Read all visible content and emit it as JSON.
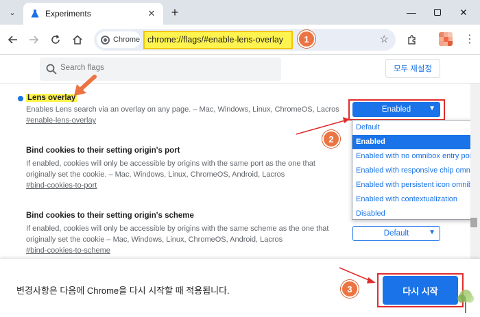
{
  "tab": {
    "title": "Experiments"
  },
  "omnibox": {
    "chip_label": "Chrome",
    "url": "chrome://flags/#enable-lens-overlay"
  },
  "flags": {
    "search_placeholder": "Search flags",
    "reset_label": "모두 재설정"
  },
  "experiments": [
    {
      "title": "Lens overlay",
      "description": "Enables Lens search via an overlay on any page. – Mac, Windows, Linux, ChromeOS, Lacros",
      "link": "#enable-lens-overlay",
      "selected": "Enabled"
    },
    {
      "title": "Bind cookies to their setting origin's port",
      "description_line1": "If enabled, cookies will only be accessible by origins with the same port as the one that",
      "description_line2": "originally set the cookie. – Mac, Windows, Linux, ChromeOS, Android, Lacros",
      "link": "#bind-cookies-to-port"
    },
    {
      "title": "Bind cookies to their setting origin's scheme",
      "description_line1": "If enabled, cookies will only be accessible by origins with the same scheme as the one that",
      "description_line2": "originally set the cookie – Mac, Windows, Linux, ChromeOS, Android, Lacros",
      "link": "#bind-cookies-to-scheme",
      "selected": "Default"
    }
  ],
  "dropdown_options": [
    "Default",
    "Enabled",
    "Enabled with no omnibox entry point",
    "Enabled with responsive chip omnibox",
    "Enabled with persistent icon omnibox",
    "Enabled with contextualization",
    "Disabled"
  ],
  "bottom": {
    "message": "변경사항은 다음에 Chrome을 다시 시작할 때 적용됩니다.",
    "relaunch_label": "다시 시작"
  },
  "annotations": {
    "badge1": "1",
    "badge2": "2",
    "badge3": "3"
  },
  "watermark": "스마트폰",
  "colors": {
    "accent": "#1a73e8",
    "highlight": "#fff44f",
    "annotation_red": "#e02b2b",
    "badge_orange": "#ec7443"
  }
}
